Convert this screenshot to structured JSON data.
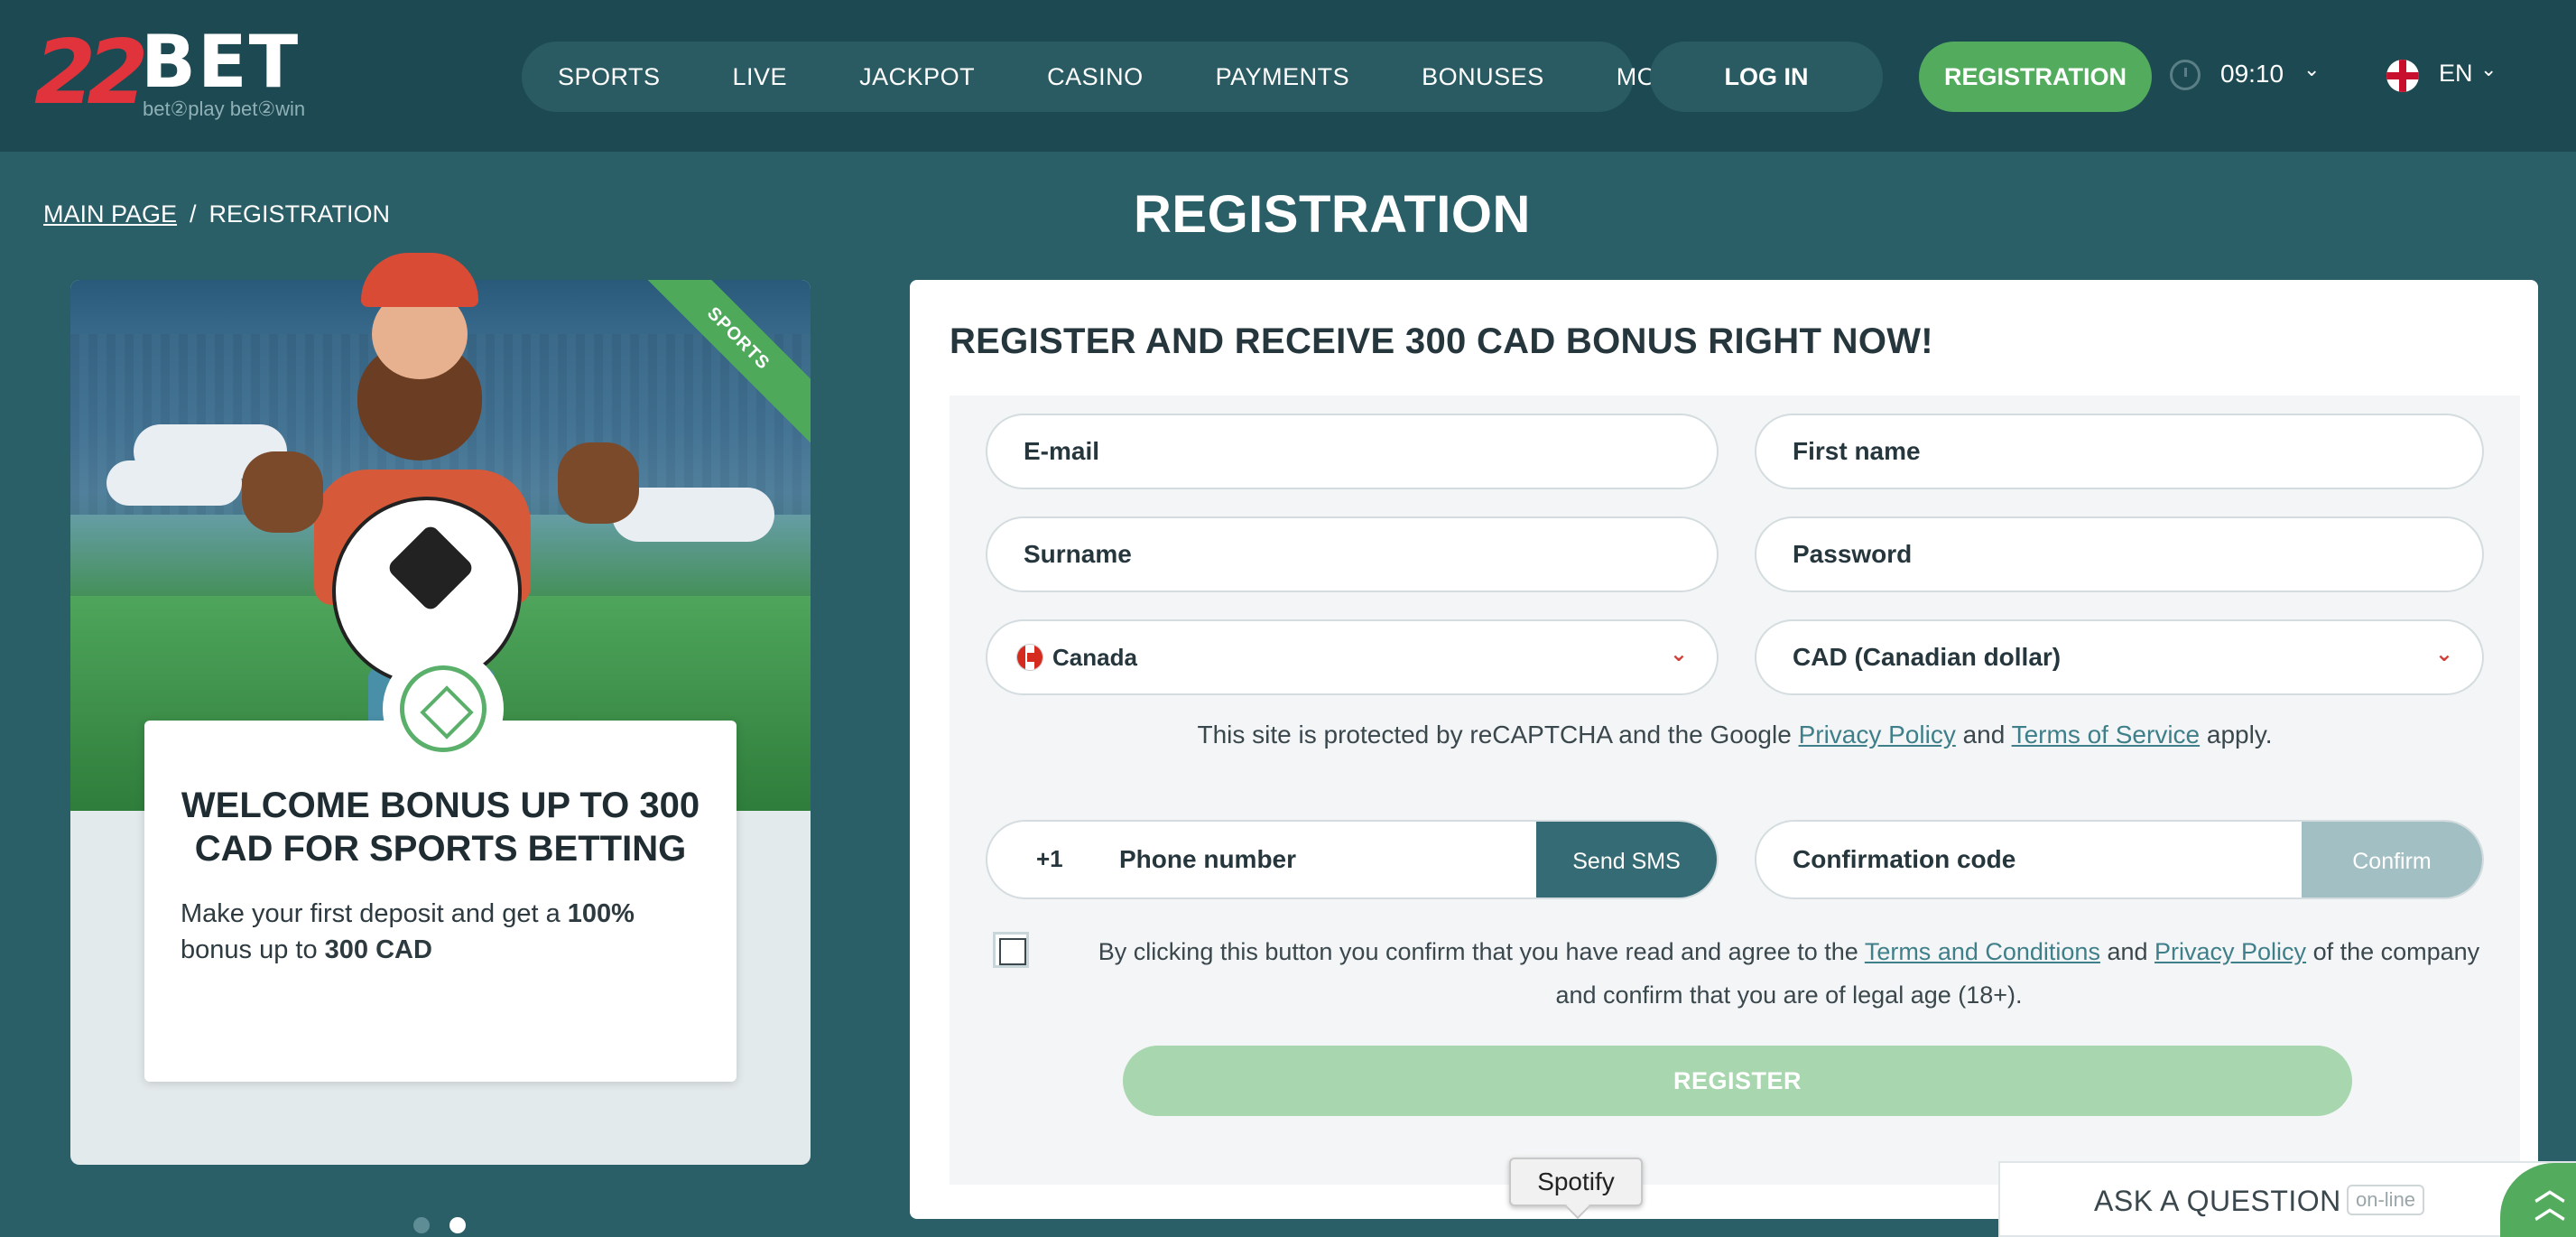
{
  "header": {
    "logo": {
      "number": "22",
      "brand": "BET",
      "tagline": "bet②play  bet②win"
    },
    "nav": [
      "SPORTS",
      "LIVE",
      "JACKPOT",
      "CASINO",
      "PAYMENTS",
      "BONUSES",
      "MORE"
    ],
    "login_label": "LOG IN",
    "registration_label": "REGISTRATION",
    "time": "09:10",
    "language": "EN"
  },
  "breadcrumb": {
    "home": "MAIN PAGE",
    "separator": "/",
    "current": "REGISTRATION"
  },
  "page_title": "REGISTRATION",
  "promo": {
    "ribbon": "SPORTS",
    "title": "WELCOME BONUS UP TO 300 CAD FOR SPORTS BETTING",
    "text_before": "Make your first deposit and get a ",
    "text_bold1": "100%",
    "text_middle": " bonus up to ",
    "text_bold2": "300 CAD",
    "slides_total": 2,
    "active_slide": 2
  },
  "form": {
    "heading": "REGISTER AND RECEIVE 300 CAD BONUS RIGHT NOW!",
    "email_placeholder": "E-mail",
    "first_name_placeholder": "First name",
    "surname_placeholder": "Surname",
    "password_placeholder": "Password",
    "country": "Canada",
    "currency": "CAD (Canadian dollar)",
    "recaptcha_prefix": "This site is protected by reCAPTCHA and the Google ",
    "recaptcha_privacy": "Privacy Policy",
    "recaptcha_and": " and ",
    "recaptcha_terms": "Terms of Service",
    "recaptcha_suffix": " apply.",
    "phone_code": "+1",
    "phone_placeholder": "Phone number",
    "send_sms": "Send SMS",
    "confirmation_placeholder": "Confirmation code",
    "confirm": "Confirm",
    "terms_prefix": "By clicking this button you confirm that you have read and agree to the ",
    "terms_link": "Terms and Conditions",
    "terms_and": " and ",
    "terms_privacy": "Privacy Policy",
    "terms_suffix": " of the company and confirm that you are of legal age (18+).",
    "register": "REGISTER"
  },
  "tooltip": "Spotify",
  "support": {
    "label": "ASK A QUESTION",
    "status": "on-line"
  },
  "colors": {
    "background": "#2b5f68",
    "header": "#1d4a52",
    "accent_green": "#53ac5e",
    "link": "#3f7f8a"
  }
}
